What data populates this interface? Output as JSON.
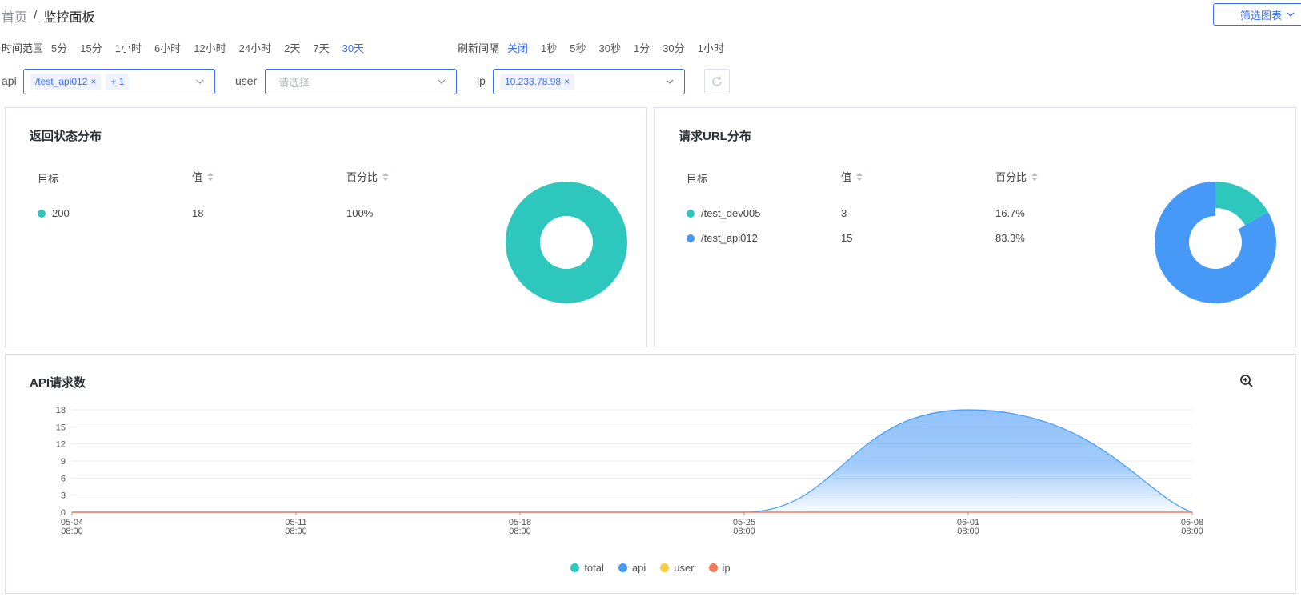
{
  "breadcrumb": {
    "home": "首页",
    "separator": "/",
    "current": "监控面板"
  },
  "filter_button": {
    "label": "筛选图表",
    "icon": "chevron-down-icon"
  },
  "time_range": {
    "label": "时间范围",
    "options": [
      "5分",
      "15分",
      "1小时",
      "6小时",
      "12小时",
      "24小时",
      "2天",
      "7天",
      "30天"
    ],
    "active": "30天"
  },
  "refresh_interval": {
    "label": "刷新间隔",
    "options": [
      "关闭",
      "1秒",
      "5秒",
      "30秒",
      "1分",
      "30分",
      "1小时"
    ],
    "active": "关闭"
  },
  "filters": {
    "api": {
      "label": "api",
      "tags": [
        "/test_api012"
      ],
      "more": "+ 1"
    },
    "user": {
      "label": "user",
      "placeholder": "请选择"
    },
    "ip": {
      "label": "ip",
      "tags": [
        "10.233.78.98"
      ]
    }
  },
  "status_panel": {
    "title": "返回状态分布",
    "columns": [
      "目标",
      "值",
      "百分比"
    ],
    "rows": [
      {
        "target": "200",
        "value": "18",
        "percent": "100%",
        "color": "#2ec7be"
      }
    ]
  },
  "url_panel": {
    "title": "请求URL分布",
    "columns": [
      "目标",
      "值",
      "百分比"
    ],
    "rows": [
      {
        "target": "/test_dev005",
        "value": "3",
        "percent": "16.7%",
        "color": "#2ec7be"
      },
      {
        "target": "/test_api012",
        "value": "15",
        "percent": "83.3%",
        "color": "#4799f7"
      }
    ]
  },
  "api_panel": {
    "title": "API请求数",
    "zoom_icon": "zoom-in-icon"
  },
  "colors": {
    "accent": "#3a6ff5",
    "teal": "#2ec7be",
    "blue": "#4799f7",
    "yellow": "#fbcb4a",
    "red": "#f37a5c"
  },
  "chart_data": [
    {
      "type": "pie",
      "title": "返回状态分布",
      "labels": [
        "200"
      ],
      "values": [
        18
      ],
      "colors": [
        "#2ec7be"
      ]
    },
    {
      "type": "pie",
      "title": "请求URL分布",
      "labels": [
        "/test_dev005",
        "/test_api012"
      ],
      "values": [
        3,
        15
      ],
      "colors": [
        "#2ec7be",
        "#4799f7"
      ]
    },
    {
      "type": "area",
      "title": "API请求数",
      "x_ticks": [
        {
          "date": "05-04",
          "time": "08:00"
        },
        {
          "date": "05-11",
          "time": "08:00"
        },
        {
          "date": "05-18",
          "time": "08:00"
        },
        {
          "date": "05-25",
          "time": "08:00"
        },
        {
          "date": "06-01",
          "time": "08:00"
        },
        {
          "date": "06-08",
          "time": "08:00"
        }
      ],
      "y_ticks": [
        0,
        3,
        6,
        9,
        12,
        15,
        18
      ],
      "ylim": [
        0,
        18
      ],
      "grid": true,
      "legend_position": "bottom",
      "series": [
        {
          "name": "total",
          "color": "#2ec7be",
          "x": [
            "05-04",
            "05-25",
            "06-01",
            "06-08"
          ],
          "values": [
            0,
            0,
            18,
            0
          ]
        },
        {
          "name": "api",
          "color": "#4799f7",
          "x": [
            "05-04",
            "05-25",
            "06-01",
            "06-08"
          ],
          "values": [
            0,
            0,
            18,
            0
          ]
        },
        {
          "name": "user",
          "color": "#fbcb4a",
          "x": [
            "05-04",
            "06-08"
          ],
          "values": [
            0,
            0
          ]
        },
        {
          "name": "ip",
          "color": "#f37a5c",
          "x": [
            "05-04",
            "06-08"
          ],
          "values": [
            0,
            0
          ]
        }
      ]
    }
  ]
}
